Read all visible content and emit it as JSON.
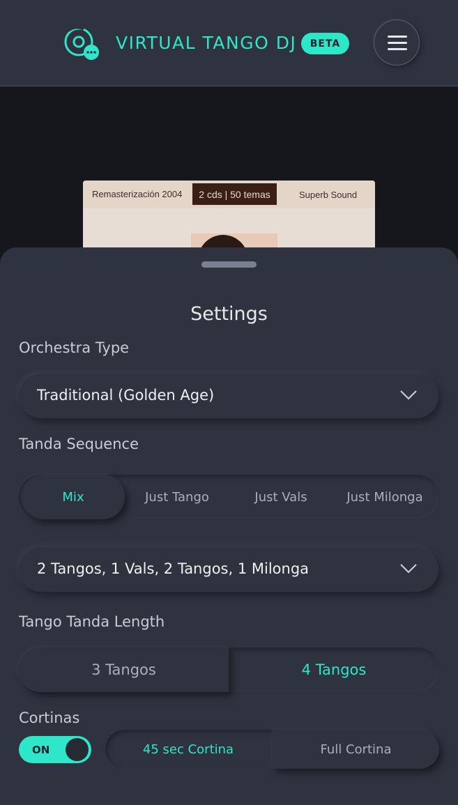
{
  "header": {
    "brand": "VIRTUAL TANGO DJ",
    "badge": "BETA",
    "logo_icon": "vinyl-disc-chat-icon",
    "menu_icon": "hamburger-menu-icon"
  },
  "album": {
    "text_left": "Remasterización 2004",
    "text_center": "2 cds | 50 temas",
    "text_right": "Superb Sound"
  },
  "settings": {
    "title": "Settings",
    "orchestra_type": {
      "label": "Orchestra Type",
      "selected": "Traditional (Golden Age)"
    },
    "tanda_sequence": {
      "label": "Tanda Sequence",
      "options": [
        "Mix",
        "Just Tango",
        "Just Vals",
        "Just Milonga"
      ],
      "active": "Mix",
      "pattern_selected": "2 Tangos, 1 Vals, 2 Tangos, 1 Milonga"
    },
    "tango_tanda_length": {
      "label": "Tango Tanda Length",
      "options": [
        "3 Tangos",
        "4 Tangos"
      ],
      "active": "4 Tangos"
    },
    "cortinas": {
      "label": "Cortinas",
      "toggle_text": "ON",
      "options": [
        "45 sec Cortina",
        "Full Cortina"
      ],
      "active": "45 sec Cortina"
    }
  },
  "colors": {
    "accent": "#2ee6c8",
    "panel": "#2f3340",
    "background": "#15171c"
  }
}
